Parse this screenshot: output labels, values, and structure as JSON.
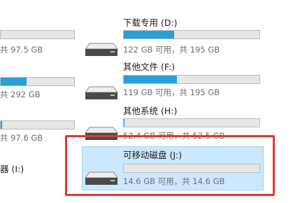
{
  "left_column": [
    {
      "label": "",
      "space_text": "共 97.5 GB",
      "used_fraction": 0.0
    },
    {
      "label": "",
      "space_text": "共 292 GB",
      "used_fraction": 0.35
    },
    {
      "label": "",
      "space_text": "共 97.6 GB",
      "used_fraction": 0.02
    },
    {
      "label": "器 (I:)",
      "space_text": ""
    }
  ],
  "drives": [
    {
      "name": "下载专用 (D:)",
      "space_text": "122 GB 可用，共 195 GB",
      "used_fraction": 0.37
    },
    {
      "name": "其他文件 (F:)",
      "space_text": "119 GB 可用，共 195 GB",
      "used_fraction": 0.39
    },
    {
      "name": "其他系统 (H:)",
      "space_text": "52.4 GB 可用，共 52.5 GB",
      "used_fraction": 0.002
    },
    {
      "name": "可移动磁盘 (J:)",
      "space_text": "14.6 GB 可用，共 14.6 GB",
      "used_fraction": 0.0,
      "selected": true
    }
  ],
  "colors": {
    "accent": "#26a0da",
    "selection": "#cce8ff",
    "highlight_box": "#e53535"
  },
  "icons": {
    "drive": "hard-drive-icon"
  }
}
